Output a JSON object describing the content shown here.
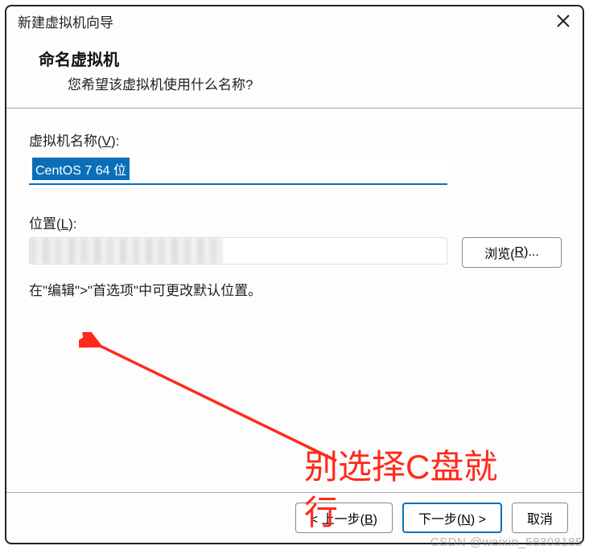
{
  "titlebar": {
    "title": "新建虚拟机向导"
  },
  "header": {
    "title": "命名虚拟机",
    "subtitle": "您希望该虚拟机使用什么名称?"
  },
  "fields": {
    "name": {
      "label_prefix": "虚拟机名称(",
      "label_underline": "V",
      "label_suffix": "):",
      "value": "CentOS 7 64 位"
    },
    "location": {
      "label_prefix": "位置(",
      "label_underline": "L",
      "label_suffix": "):",
      "value": "",
      "browse_prefix": "浏览(",
      "browse_underline": "R",
      "browse_suffix": ")..."
    },
    "hint": "在\"编辑\">\"首选项\"中可更改默认位置。"
  },
  "annotation": {
    "line1": "别选择C盘就",
    "line2": "行"
  },
  "footer": {
    "back_prefix": "< 上一步(",
    "back_underline": "B",
    "back_suffix": ")",
    "next_prefix": "下一步(",
    "next_underline": "N",
    "next_suffix": ") >",
    "cancel": "取消"
  },
  "watermark": "CSDN @weixin_58308185"
}
